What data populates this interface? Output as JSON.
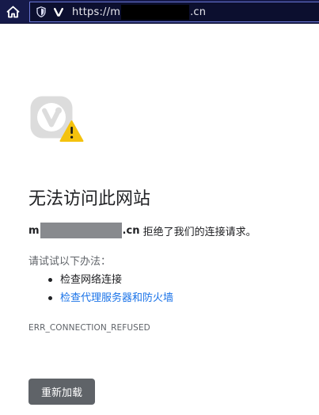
{
  "browser": {
    "url_prefix": "https://m",
    "url_suffix": ".cn",
    "icons": [
      "home-icon",
      "shield-icon",
      "vivaldi-icon"
    ]
  },
  "error": {
    "title": "无法访问此网站",
    "host_prefix": "m",
    "host_suffix": ".cn",
    "message": " 拒绝了我们的连接请求。",
    "try_label": "请试试以下办法：",
    "suggestions": [
      {
        "label": "检查网络连接",
        "is_link": false
      },
      {
        "label": "检查代理服务器和防火墙",
        "is_link": true
      }
    ],
    "code": "ERR_CONNECTION_REFUSED",
    "reload_label": "重新加载"
  },
  "colors": {
    "topbar_bg": "#161a4a",
    "addressbar_border": "#6a76d6",
    "link": "#1a73e8",
    "button_bg": "#5f6368",
    "warning": "#f4c20d"
  }
}
